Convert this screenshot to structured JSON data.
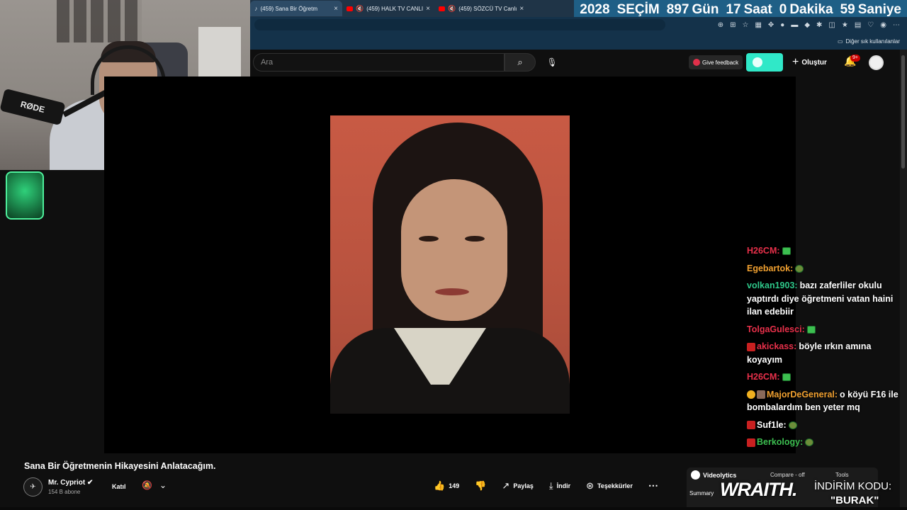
{
  "browser": {
    "tabs": [
      {
        "label": "(459) Sana Bir Öğretm",
        "close": "×"
      },
      {
        "label": "(459) HALK TV CANLI",
        "close": "×"
      },
      {
        "label": "(459) SÖZCÜ TV Canlı",
        "close": "×"
      }
    ],
    "bookmarks_label": "Diğer sık kullanılanlar"
  },
  "countdown": {
    "year": "2028",
    "title": "SEÇİM",
    "days_num": "897",
    "days_unit": "Gün",
    "hours_num": "17",
    "hours_unit": "Saat",
    "minutes_num": "0",
    "minutes_unit": "Dakika",
    "seconds_num": "59",
    "seconds_unit": "Saniye"
  },
  "header": {
    "search_placeholder": "Ara",
    "feedback_label": "Give feedback",
    "create_label": "Oluştur",
    "notifications_badge": "9+"
  },
  "webcam": {
    "mic_brand": "RØDE"
  },
  "chat": [
    {
      "user": "H26CM:",
      "color": "#e8304a",
      "text": "",
      "emote": "green"
    },
    {
      "user": "Egebartok:",
      "color": "#f0a030",
      "text": "",
      "emote": "frog"
    },
    {
      "user": "volkan1903:",
      "color": "#2ec88a",
      "text": "bazı zaferliler okulu yaptırdı diye öğretmeni vatan haini ilan edebiir",
      "emote": ""
    },
    {
      "user": "TolgaGulesci:",
      "color": "#e8304a",
      "text": "",
      "emote": "green"
    },
    {
      "user": "akickass:",
      "color": "#e8304a",
      "text": "böyle ırkın amına koyayım",
      "emote": ""
    },
    {
      "user": "H26CM:",
      "color": "#e8304a",
      "text": "",
      "emote": "green"
    },
    {
      "user": "MajorDeGeneral:",
      "color": "#f0a030",
      "text": "o köyü F16 ile bombalardım ben yeter mq",
      "emote": ""
    },
    {
      "user": "Suf1le:",
      "color": "#ffffff",
      "text": "",
      "emote": "frog"
    },
    {
      "user": "Berkology:",
      "color": "#3cbf50",
      "text": "",
      "emote": "frog"
    }
  ],
  "video": {
    "title": "Sana Bir Öğretmenin Hikayesini Anlatacağım.",
    "channel_name": "Mr. Cypriot",
    "channel_subs": "154 B abone",
    "join_label": "Katıl",
    "likes": "149",
    "share_label": "Paylaş",
    "download_label": "İndir",
    "thanks_label": "Teşekkürler"
  },
  "videolytics": {
    "name": "Videolytics",
    "compare": "Compare - off",
    "tools": "Tools",
    "tab_summary": "Summary"
  },
  "promo": {
    "brand": "WRAITH.",
    "line1": "İNDİRİM KODU:",
    "line2": "\"BURAK\""
  },
  "colors": {
    "accent_teal": "#30e8c8",
    "countdown_bg": "#1f5f86",
    "photo_bg": "#c85a44"
  }
}
